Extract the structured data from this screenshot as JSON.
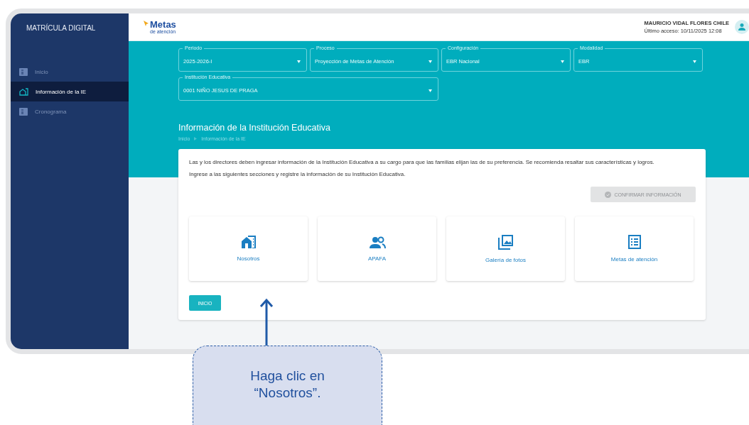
{
  "sidebar": {
    "title": "MATRÍCULA DIGITAL",
    "items": [
      {
        "kind": "grid",
        "label": "Inicio",
        "selected": false
      },
      {
        "kind": "building",
        "label": "Información de la IE",
        "selected": true
      },
      {
        "kind": "grid",
        "label": "Cronograma",
        "selected": false
      }
    ]
  },
  "header": {
    "logo": {
      "title": "Metas",
      "subtitle": "de atención"
    },
    "user": {
      "name": "MAURICIO VIDAL FLORES CHILE",
      "last_access": "Último acceso: 10/11/2025 12:08"
    }
  },
  "filters": [
    {
      "label": "Periodo",
      "value": "2025-2026-I"
    },
    {
      "label": "Proceso",
      "value": "Proyección de Metas de Atención"
    },
    {
      "label": "Configuración",
      "value": "EBR Nacional"
    },
    {
      "label": "Modalidad",
      "value": "EBR"
    },
    {
      "label": "Institución Educativa",
      "value": "0001 NIÑO JESUS DE PRAGA"
    }
  ],
  "page": {
    "title": "Información de la Institución Educativa",
    "breadcrumb": [
      "Inicio",
      "Información de la IE"
    ]
  },
  "card": {
    "intro": "Las y los directores deben ingresar información de la Institución Educativa a su cargo para que las familias elijan las de su preferencia. Se recomienda resaltar sus características y logros.",
    "instruction": "Ingrese a las siguientes secciones y registre la información de su Institución Educativa.",
    "confirm_button": {
      "label": "CONFIRMAR INFORMACIÓN",
      "disabled": true
    },
    "sections": [
      {
        "kind": "building",
        "label": "Nosotros"
      },
      {
        "kind": "people",
        "label": "APAFA"
      },
      {
        "kind": "gallery",
        "label": "Galería de fotos"
      },
      {
        "kind": "list",
        "label": "Metas de atención"
      }
    ],
    "home_button": "INICIO"
  },
  "callout": {
    "text": "Haga clic en “Nosotros”."
  }
}
